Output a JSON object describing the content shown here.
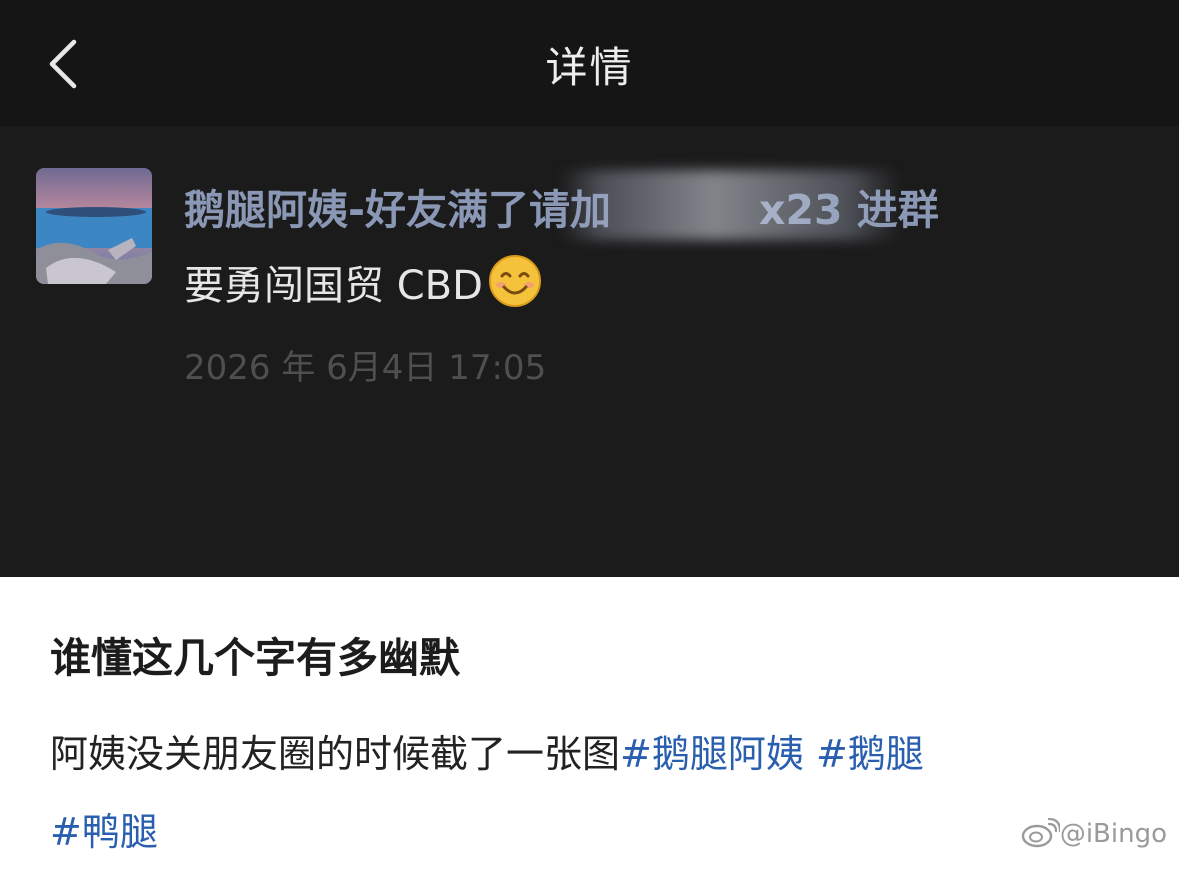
{
  "navbar": {
    "title": "详情",
    "back_icon": "chevron-left-icon"
  },
  "post": {
    "author_visible": "鹅腿阿姨-好友满了请加",
    "author_tail": "x23 进群",
    "text": "要勇闯国贸 CBD",
    "emoji": "smiling-face-icon",
    "timestamp": "2026 年 6月4日 17:05"
  },
  "caption": {
    "title": "谁懂这几个字有多幽默",
    "body": "阿姨没关朋友圈的时候截了一张图",
    "tags": [
      "#鹅腿阿姨",
      "#鹅腿",
      "#鸭腿"
    ]
  },
  "watermark": {
    "text": "@iBingo",
    "icon": "weibo-icon"
  },
  "colors": {
    "nav_bg": "#151515",
    "post_bg": "#1b1b1b",
    "nickname": "#8a98b6",
    "tag": "#2a5fb0"
  }
}
